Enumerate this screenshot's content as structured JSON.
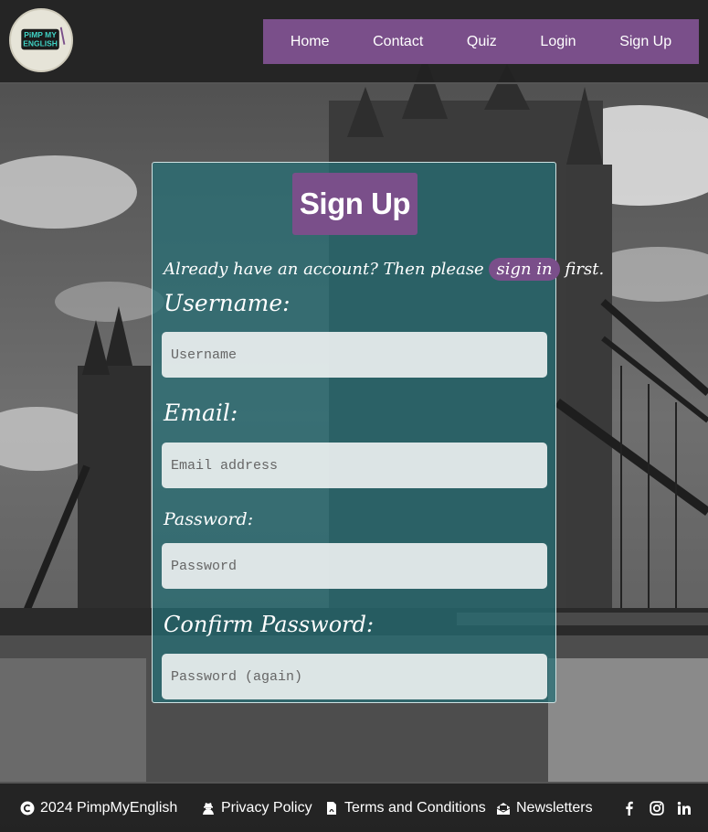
{
  "logo": {
    "alt": "PimpMyEnglish logo",
    "line1": "PiMP MY",
    "line2": "ENGLISH"
  },
  "nav": {
    "items": [
      {
        "label": "Home"
      },
      {
        "label": "Contact"
      },
      {
        "label": "Quiz"
      },
      {
        "label": "Login"
      },
      {
        "label": "Sign Up"
      }
    ]
  },
  "form": {
    "title": "Sign Up",
    "signin_prefix": "Already have an account? Then please",
    "signin_link": "sign in",
    "signin_suffix": "first.",
    "username_label": "Username:",
    "username_placeholder": "Username",
    "email_label": "Email:",
    "email_placeholder": "Email address",
    "password_label": "Password:",
    "password_placeholder": "Password",
    "confirm_label": "Confirm Password:",
    "confirm_placeholder": "Password (again)"
  },
  "footer": {
    "copyright": "2024 PimpMyEnglish",
    "privacy": "Privacy Policy",
    "terms": "Terms and Conditions",
    "newsletters": "Newsletters",
    "social": [
      {
        "icon": "facebook-icon"
      },
      {
        "icon": "instagram-icon"
      },
      {
        "icon": "linkedin-icon"
      }
    ]
  },
  "colors": {
    "accent": "#7a4f8a",
    "card": "#266e76",
    "header": "#222222"
  }
}
